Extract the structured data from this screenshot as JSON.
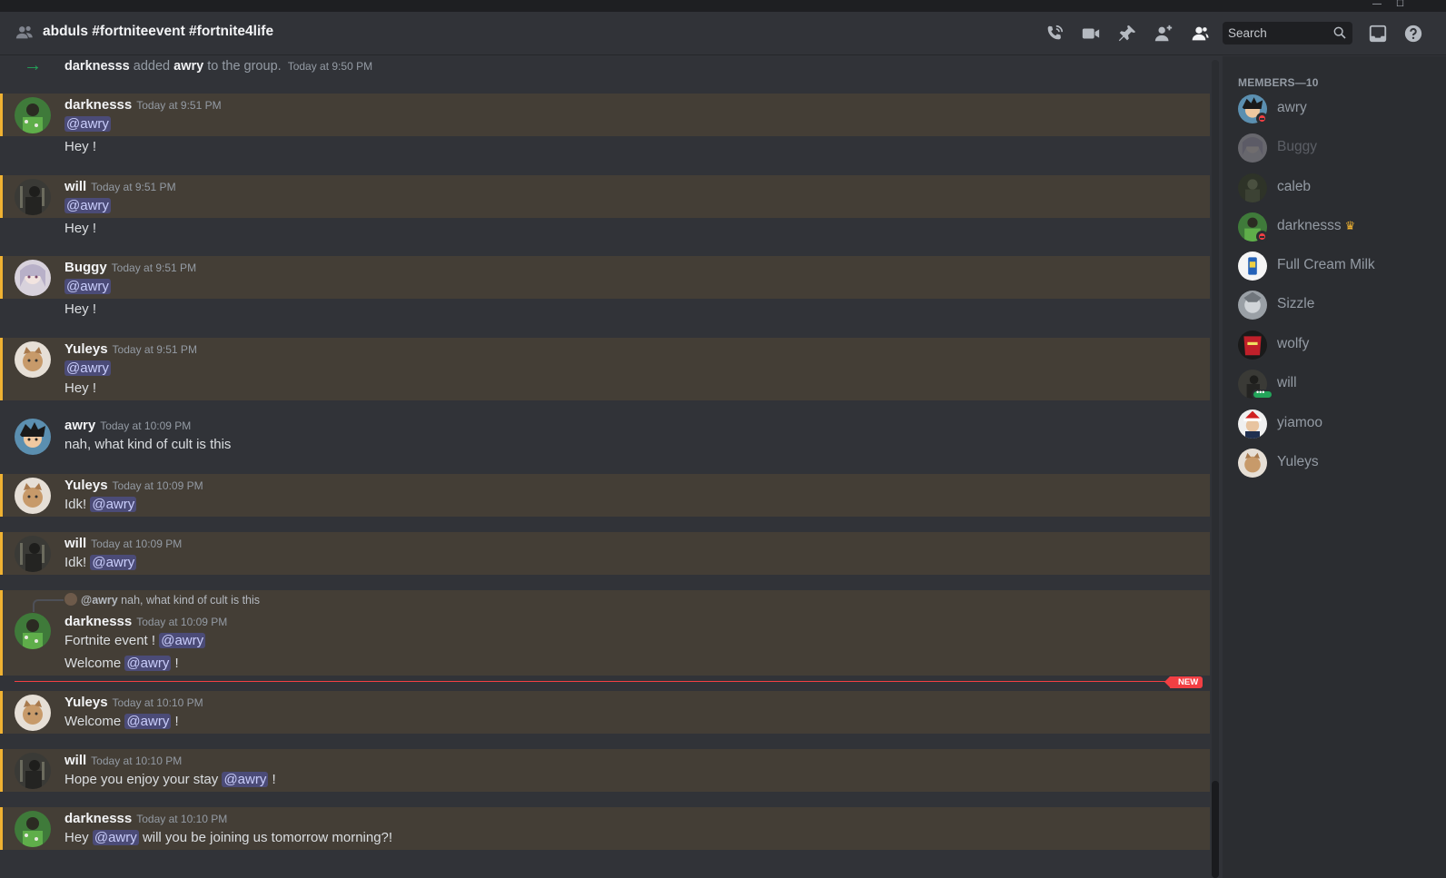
{
  "window": {
    "minimize": "—",
    "maximize": "☐"
  },
  "header": {
    "title": "abduls #fortniteevent #fortnite4life",
    "search_placeholder": "Search"
  },
  "system_message": {
    "actor": "darknesss",
    "verb": "added",
    "target": "awry",
    "suffix": "to the group.",
    "timestamp": "Today at 9:50 PM"
  },
  "messages": [
    {
      "author": "darknesss",
      "timestamp": "Today at 9:51 PM",
      "line1_mention": "@awry",
      "line2_text": "Hey !"
    },
    {
      "author": "will",
      "timestamp": "Today at 9:51 PM",
      "line1_mention": "@awry",
      "line2_text": "Hey !"
    },
    {
      "author": "Buggy",
      "timestamp": "Today at 9:51 PM",
      "line1_mention": "@awry",
      "line2_text": "Hey !"
    },
    {
      "author": "Yuleys",
      "timestamp": "Today at 9:51 PM",
      "line1_mention": "@awry",
      "line2_text": "Hey !"
    },
    {
      "author": "awry",
      "timestamp": "Today at 10:09 PM",
      "text": "nah, what kind of cult is this"
    },
    {
      "author": "Yuleys",
      "timestamp": "Today at 10:09 PM",
      "text": "Idk!",
      "mention": "@awry"
    },
    {
      "author": "will",
      "timestamp": "Today at 10:09 PM",
      "text": "Idk!",
      "mention": "@awry"
    },
    {
      "author": "darknesss",
      "timestamp": "Today at 10:09 PM",
      "reply_to": {
        "mention": "@awry",
        "text": "nah, what kind of cult is this"
      },
      "line1_text": "Fortnite event !",
      "line1_mention": "@awry",
      "line2_text": "Welcome",
      "line2_mention": "@awry",
      "line2_suffix": "!"
    },
    {
      "author": "Yuleys",
      "timestamp": "Today at 10:10 PM",
      "text": "Welcome",
      "mention": "@awry",
      "suffix": "!"
    },
    {
      "author": "will",
      "timestamp": "Today at 10:10 PM",
      "text": "Hope you enjoy your stay",
      "mention": "@awry",
      "suffix": "!"
    },
    {
      "author": "darknesss",
      "timestamp": "Today at 10:10 PM",
      "text": "Hey",
      "mention": "@awry",
      "suffix": "will you be joining us tomorrow morning?!"
    }
  ],
  "new_badge": "NEW",
  "members": {
    "header": "MEMBERS—10",
    "list": [
      {
        "name": "awry",
        "status": "dnd"
      },
      {
        "name": "Buggy",
        "status": "offline"
      },
      {
        "name": "caleb",
        "status": "none"
      },
      {
        "name": "darknesss",
        "status": "dnd",
        "owner": true
      },
      {
        "name": "Full Cream Milk",
        "status": "none"
      },
      {
        "name": "Sizzle",
        "status": "none"
      },
      {
        "name": "wolfy",
        "status": "none"
      },
      {
        "name": "will",
        "status": "typing"
      },
      {
        "name": "yiamoo",
        "status": "none"
      },
      {
        "name": "Yuleys",
        "status": "none"
      }
    ],
    "owner_icon": "crown-icon"
  },
  "colors": {
    "background": "#313338",
    "members_bg": "#2b2d31",
    "highlight_bg": "#443e36",
    "highlight_bar": "#f0b232",
    "mention_bg": "#4a4f8c",
    "new_divider": "#f23f43",
    "dnd": "#f23f43",
    "online": "#23a55a"
  },
  "icons": [
    "people-icon",
    "phone-call-icon",
    "video-icon",
    "pin-icon",
    "add-member-icon",
    "members-icon",
    "search-icon",
    "inbox-icon",
    "help-icon",
    "arrow-right-icon"
  ]
}
